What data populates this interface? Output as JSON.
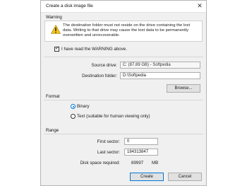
{
  "window": {
    "title": "Create a disk image file"
  },
  "warning": {
    "group_title": "Warning",
    "icon": "warning-triangle-icon",
    "line1": "The destination folder must not reside on the drive containing the lost",
    "line2": "data. Writing to that drive may cause the lost data to be permanently",
    "line3": "overwritten and unrecoverable.",
    "ack_label": "I have read the WARNING above.",
    "ack_checked": true
  },
  "source": {
    "label": "Source drive:",
    "value": "C: (87.89 GB) - Softpedia"
  },
  "destination": {
    "label": "Destination folder:",
    "value": "D:\\Softpedia",
    "browse_label": "Browse..."
  },
  "format": {
    "group_title": "Format",
    "options": [
      {
        "label": "Binary",
        "selected": true
      },
      {
        "label": "Text (suitable for human viewing only)",
        "selected": false
      }
    ]
  },
  "range": {
    "group_title": "Range",
    "first_label": "First sector:",
    "first_value": "0",
    "last_label": "Last sector:",
    "last_value": "184313847",
    "space_label": "Disk space required:",
    "space_value": "89997",
    "space_unit": "MB"
  },
  "buttons": {
    "create_label": "Create",
    "cancel_label": "Cancel"
  },
  "colors": {
    "accent": "#0078d7",
    "warning": "#f5c518"
  }
}
